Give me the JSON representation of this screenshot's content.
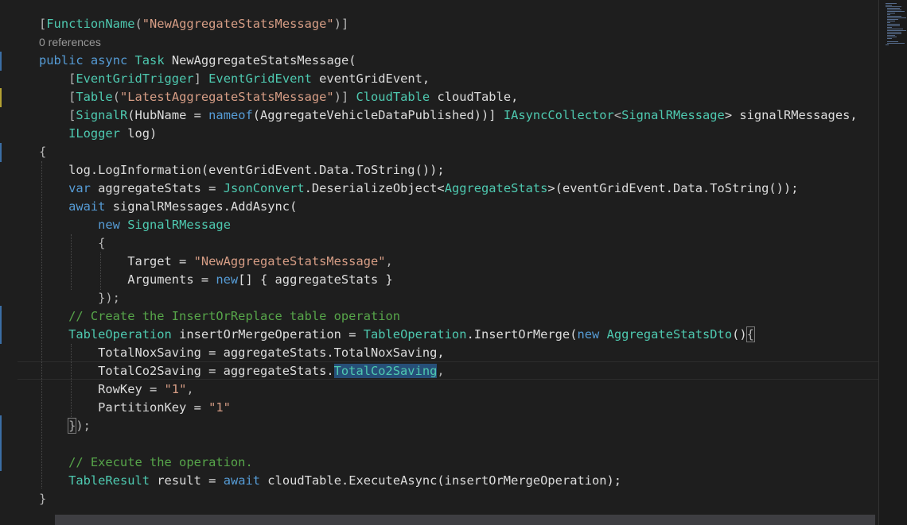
{
  "editor": {
    "code_lens": "0 references",
    "lines": [
      [
        [
          "[",
          "pu"
        ],
        [
          "FunctionName",
          "ty"
        ],
        [
          "(",
          "pu"
        ],
        [
          "\"NewAggregateStatsMessage\"",
          "str"
        ],
        [
          ")]",
          "pu"
        ]
      ],
      "LENS",
      [
        [
          "public",
          "kw"
        ],
        [
          " ",
          "pu"
        ],
        [
          "async",
          "kw"
        ],
        [
          " ",
          "pu"
        ],
        [
          "Task",
          "ty"
        ],
        [
          " NewAggregateStatsMessage(",
          "id"
        ]
      ],
      [
        [
          "    [",
          "pu"
        ],
        [
          "EventGridTrigger",
          "ty"
        ],
        [
          "] ",
          "pu"
        ],
        [
          "EventGridEvent",
          "ty"
        ],
        [
          " eventGridEvent,",
          "id"
        ]
      ],
      [
        [
          "    [",
          "pu"
        ],
        [
          "Table",
          "ty"
        ],
        [
          "(",
          "pu"
        ],
        [
          "\"LatestAggregateStatsMessage\"",
          "str"
        ],
        [
          ")] ",
          "pu"
        ],
        [
          "CloudTable",
          "ty"
        ],
        [
          " cloudTable,",
          "id"
        ]
      ],
      [
        [
          "    [",
          "pu"
        ],
        [
          "SignalR",
          "ty"
        ],
        [
          "(HubName = ",
          "id"
        ],
        [
          "nameof",
          "kw"
        ],
        [
          "(AggregateVehicleDataPublished))] ",
          "id"
        ],
        [
          "IAsyncCollector",
          "ty"
        ],
        [
          "<",
          "pu"
        ],
        [
          "SignalRMessage",
          "ty"
        ],
        [
          "> signalRMessages,",
          "id"
        ]
      ],
      [
        [
          "    ",
          "pu"
        ],
        [
          "ILogger",
          "ty"
        ],
        [
          " log)",
          "id"
        ]
      ],
      [
        [
          "{",
          "pu"
        ]
      ],
      [
        [
          "    log.LogInformation(eventGridEvent.Data.ToString());",
          "id"
        ]
      ],
      [
        [
          "    ",
          "pu"
        ],
        [
          "var",
          "kw"
        ],
        [
          " aggregateStats = ",
          "id"
        ],
        [
          "JsonConvert",
          "ty"
        ],
        [
          ".DeserializeObject<",
          "id"
        ],
        [
          "AggregateStats",
          "ty"
        ],
        [
          ">(eventGridEvent.Data.ToString());",
          "id"
        ]
      ],
      [
        [
          "    ",
          "pu"
        ],
        [
          "await",
          "kw"
        ],
        [
          " signalRMessages.AddAsync(",
          "id"
        ]
      ],
      [
        [
          "        ",
          "pu"
        ],
        [
          "new",
          "kw"
        ],
        [
          " ",
          "pu"
        ],
        [
          "SignalRMessage",
          "ty"
        ]
      ],
      [
        [
          "        {",
          "pu"
        ]
      ],
      [
        [
          "            Target = ",
          "id"
        ],
        [
          "\"NewAggregateStatsMessage\"",
          "str"
        ],
        [
          ",",
          "pu"
        ]
      ],
      [
        [
          "            Arguments = ",
          "id"
        ],
        [
          "new",
          "kw"
        ],
        [
          "[] { aggregateStats }",
          "id"
        ]
      ],
      [
        [
          "        });",
          "pu"
        ]
      ],
      [
        [
          "    // Create the InsertOrReplace table operation",
          "cm"
        ]
      ],
      [
        [
          "    ",
          "pu"
        ],
        [
          "TableOperation",
          "ty"
        ],
        [
          " insertOrMergeOperation = ",
          "id"
        ],
        [
          "TableOperation",
          "ty"
        ],
        [
          ".InsertOrMerge(",
          "id"
        ],
        [
          "new",
          "kw"
        ],
        [
          " ",
          "pu"
        ],
        [
          "AggregateStatsDto",
          "ty"
        ],
        [
          "()",
          "id"
        ],
        [
          "{",
          "hl"
        ]
      ],
      [
        [
          "        TotalNoxSaving = aggregateStats.TotalNoxSaving,",
          "id"
        ]
      ],
      [
        [
          "        TotalCo2Saving = aggregateStats.",
          "id"
        ],
        [
          "TotalCo2Saving",
          "sel"
        ],
        [
          ",",
          "pu"
        ]
      ],
      [
        [
          "        RowKey = ",
          "id"
        ],
        [
          "\"1\"",
          "str"
        ],
        [
          ",",
          "pu"
        ]
      ],
      [
        [
          "        PartitionKey = ",
          "id"
        ],
        [
          "\"1\"",
          "str"
        ]
      ],
      [
        [
          "    ",
          "pu"
        ],
        [
          "}",
          "hl"
        ],
        [
          ");",
          "pu"
        ]
      ],
      [
        [
          "",
          "pu"
        ]
      ],
      [
        [
          "    // Execute the operation.",
          "cm"
        ]
      ],
      [
        [
          "    ",
          "pu"
        ],
        [
          "TableResult",
          "ty"
        ],
        [
          " result = ",
          "id"
        ],
        [
          "await",
          "kw"
        ],
        [
          " cloudTable.ExecuteAsync(insertOrMergeOperation);",
          "id"
        ]
      ],
      [
        [
          "}",
          "pu"
        ]
      ]
    ]
  },
  "colors": {
    "background": "#1e1e1e",
    "keyword": "#569cd6",
    "type": "#4ec9b0",
    "string": "#d69d85",
    "comment": "#57a64a",
    "identifier": "#dcdcdc",
    "selection": "#264f78"
  }
}
